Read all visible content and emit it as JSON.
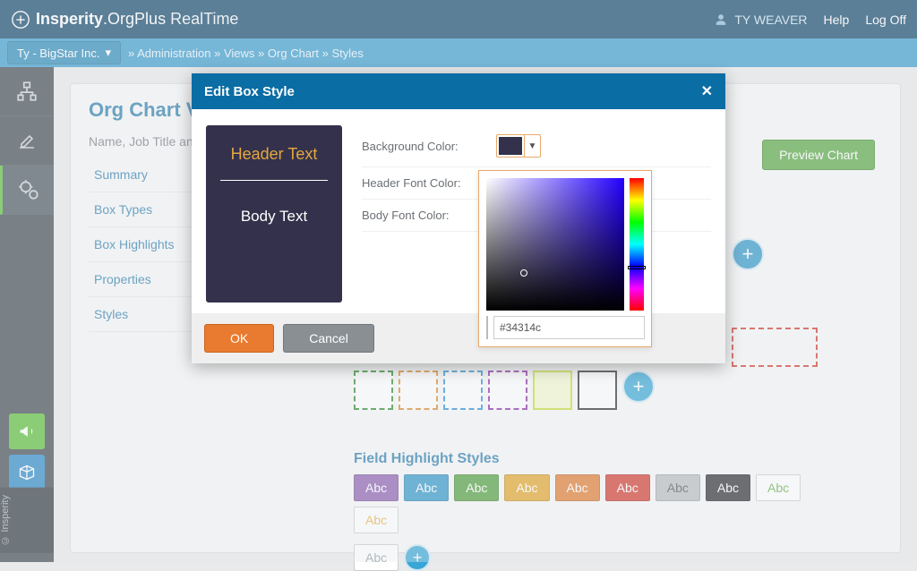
{
  "brand": {
    "company": "Insperity",
    "product": "OrgPlus",
    "suffix": "RealTime"
  },
  "topbar": {
    "user": "TY WEAVER",
    "help": "Help",
    "logoff": "Log Off"
  },
  "subbar": {
    "org": "Ty - BigStar Inc.",
    "crumbs": [
      "Administration",
      "Views",
      "Org Chart",
      "Styles"
    ]
  },
  "panel": {
    "title": "Org Chart View",
    "sub": "Name, Job Title and",
    "tabs": [
      "Summary",
      "Box Types",
      "Box Highlights",
      "Properties",
      "Styles"
    ],
    "preview_btn": "Preview Chart",
    "field_highlight_title": "Field Highlight Styles",
    "abc_label": "Abc",
    "abc_colors": [
      "#8b5fb0",
      "#2f96c8",
      "#4f9e3e",
      "#e2a62a",
      "#e07b2f",
      "#d13a2f",
      "#9aa0a5",
      "#2b2d30"
    ],
    "abc_outline": [
      "#63b148",
      "#e6b24a"
    ],
    "dashed_colors": [
      "#2e8b2e",
      "#d98a2a",
      "#2f8fcf",
      "#cc2f2f",
      "#8a2fa8"
    ],
    "solid_colors": [
      {
        "border": "#c7dc3a",
        "bg": "#eef7c7"
      },
      {
        "border": "#2b2d30",
        "bg": "#ffffff"
      }
    ],
    "red_dash": "#d13a2f"
  },
  "modal": {
    "title": "Edit Box Style",
    "preview": {
      "header": "Header Text",
      "body": "Body Text"
    },
    "labels": {
      "bg": "Background Color:",
      "hfont": "Header Font Color:",
      "bfont": "Body Font Color:"
    },
    "ok": "OK",
    "cancel": "Cancel",
    "swatch": "#34314c",
    "hex": "#34314c"
  },
  "copyright": "© Insperity"
}
